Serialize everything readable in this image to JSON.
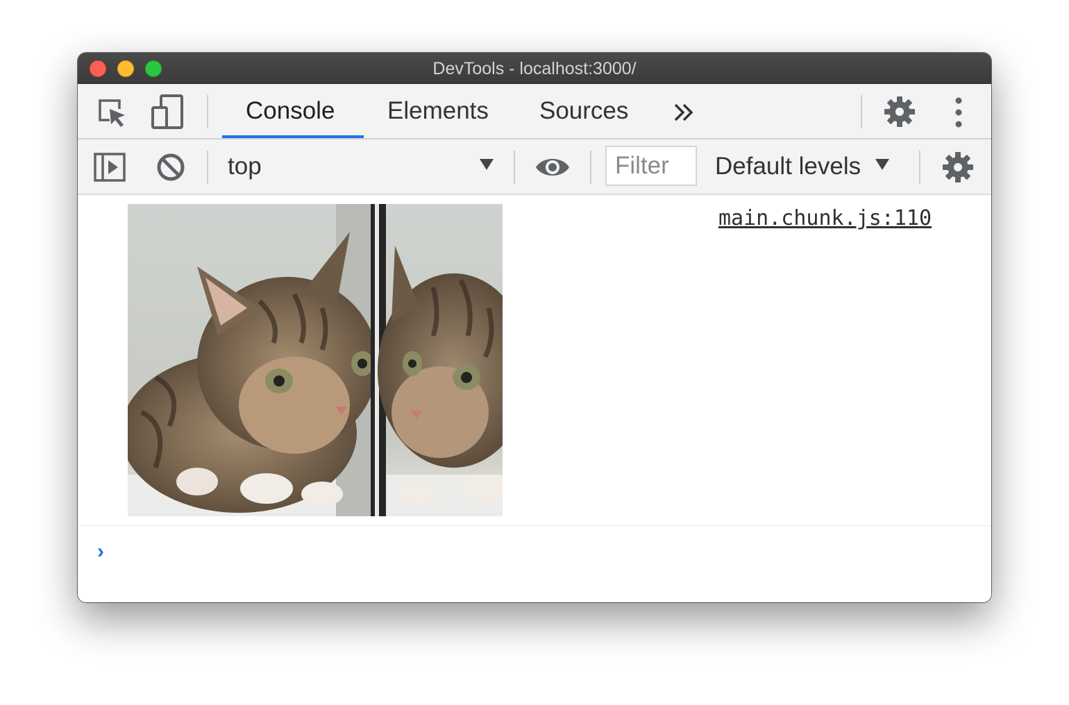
{
  "window": {
    "title": "DevTools - localhost:3000/",
    "traffic_lights": {
      "close": "#fd5f57",
      "minimize": "#febc2e",
      "zoom": "#29c840"
    }
  },
  "main_toolbar": {
    "tabs": [
      {
        "label": "Console",
        "active": true
      },
      {
        "label": "Elements",
        "active": false
      },
      {
        "label": "Sources",
        "active": false
      }
    ],
    "more_tabs_icon": "double-chevron-right-icon",
    "settings_icon": "gear-icon",
    "menu_icon": "vertical-ellipsis-icon",
    "accent_color": "#1a73e8"
  },
  "console_toolbar": {
    "context": "top",
    "filter_placeholder": "Filter",
    "levels_label": "Default levels"
  },
  "console": {
    "messages": [
      {
        "type": "image",
        "subject": "tabby kitten with mirror reflection",
        "source": "main.chunk.js:110"
      }
    ],
    "prompt_symbol": "›"
  }
}
